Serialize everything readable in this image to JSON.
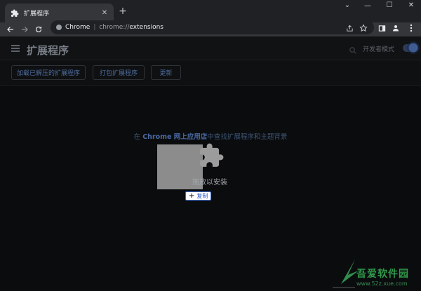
{
  "tab": {
    "title": "扩展程序",
    "close": "✕"
  },
  "newtab": "+",
  "window_controls": {
    "dropdown": "⌄",
    "minimize": "—",
    "maximize": "☐",
    "close": "✕"
  },
  "omnibox": {
    "host": "Chrome",
    "separator": "|",
    "scheme": "chrome://",
    "path": "extensions"
  },
  "header": {
    "title": "扩展程序",
    "devmode_label": "开发者模式"
  },
  "actions": {
    "load_unpacked": "加载已解压的扩展程序",
    "pack": "打包扩展程序",
    "update": "更新"
  },
  "main": {
    "store_prefix": "在 ",
    "store_link": "Chrome 网上应用店",
    "store_suffix": "中查找扩展程序和主题背景",
    "drop_text": "拖放以安装",
    "copy_badge": "复制",
    "copy_plus": "+"
  },
  "watermark": {
    "text": "吾爱软件园",
    "url": "www.52z.xue.com"
  },
  "colors": {
    "accent": "#4a6aa3",
    "tab_bg": "#35363a",
    "page_bg": "#0b0c0e"
  }
}
